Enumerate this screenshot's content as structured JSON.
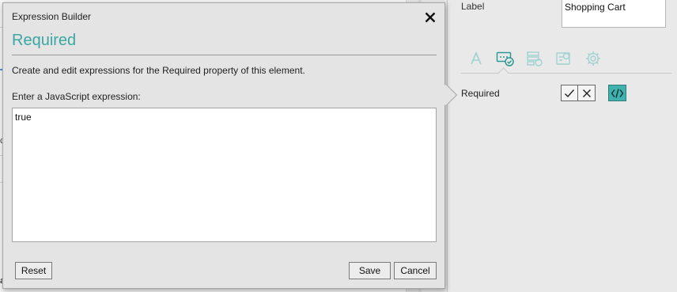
{
  "dialog": {
    "title": "Expression Builder",
    "heading": "Required",
    "description": "Create and edit expressions for the Required property of this element.",
    "prompt": "Enter a JavaScript expression:",
    "expression_value": "true",
    "buttons": {
      "reset": "Reset",
      "save": "Save",
      "cancel": "Cancel"
    },
    "close_icon": "close-icon"
  },
  "properties_panel": {
    "label_caption": "Label",
    "label_value": "Shopping Cart",
    "tabs": [
      {
        "icon": "text-format-icon",
        "active": false
      },
      {
        "icon": "validation-icon",
        "active": true
      },
      {
        "icon": "data-list-icon",
        "active": false
      },
      {
        "icon": "form-settings-icon",
        "active": false
      },
      {
        "icon": "gear-icon",
        "active": false
      }
    ],
    "required_label": "Required",
    "required_options": [
      "check-icon",
      "x-icon"
    ],
    "expression_button_icon": "code-icon"
  },
  "colors": {
    "accent": "#3aa7a3",
    "accent_button": "#3fb2ad",
    "dialog_background": "#e4e4e4"
  }
}
